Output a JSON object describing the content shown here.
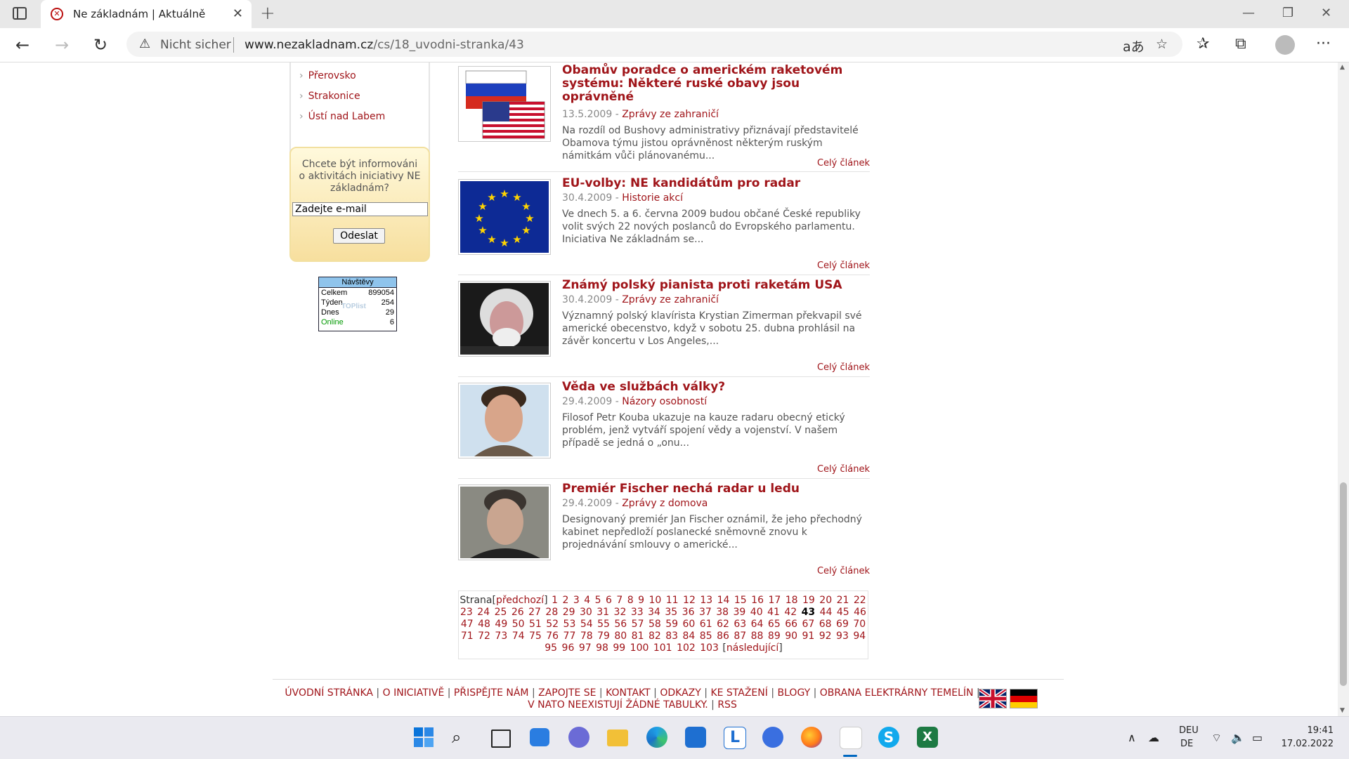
{
  "browser": {
    "tab_title": "Ne základnám | Aktuálně",
    "not_secure": "Nicht sicher",
    "url_domain": "www.nezakladnam.cz",
    "url_path": "/cs/18_uvodni-stranka/43"
  },
  "sidebar": {
    "regions": [
      "Přerovsko",
      "Strakonice",
      "Ústí nad Labem"
    ],
    "newsletter": {
      "prompt": "Chcete být informováni o aktivitách iniciativy NE základnám?",
      "placeholder": "Zadejte e-mail",
      "button": "Odeslat"
    },
    "counter": {
      "title": "Návštěvy",
      "rows": [
        {
          "label": "Celkem",
          "value": "899054"
        },
        {
          "label": "Týden",
          "value": "254"
        },
        {
          "label": "Dnes",
          "value": "29"
        },
        {
          "label": "Online",
          "value": "6"
        }
      ],
      "watermark": "TOPlist"
    }
  },
  "articles": [
    {
      "title": "Obamův poradce o americkém raketovém systému: Některé ruské obavy jsou oprávněné",
      "date": "13.5.2009",
      "category": "Zprávy ze zahraničí",
      "excerpt": "Na rozdíl od Bushovy administrativy přiznávají představitelé Obamova týmu jistou oprávněnost některým ruským námitkám vůči plánovanému...",
      "more": "Celý článek",
      "thumb": "flags-russia-usa"
    },
    {
      "title": "EU-volby: NE kandidátům pro radar",
      "date": "30.4.2009",
      "category": "Historie akcí",
      "excerpt": "Ve dnech 5. a 6. června 2009 budou občané České republiky volit svých 22 nových poslanců do Evropského parlamentu. Iniciativa Ne základnám se...",
      "more": "Celý článek",
      "thumb": "eu-flag"
    },
    {
      "title": "Známý polský pianista proti raketám USA",
      "date": "30.4.2009",
      "category": "Zprávy ze zahraničí",
      "excerpt": "Významný polský klavírista Krystian Zimerman překvapil své americké obecenstvo, když v sobotu 25. dubna prohlásil na závěr koncertu v Los Angeles,...",
      "more": "Celý článek",
      "thumb": "portrait-pianist"
    },
    {
      "title": "Věda ve službách války?",
      "date": "29.4.2009",
      "category": "Názory osobností",
      "excerpt": "Filosof Petr Kouba ukazuje na kauze radaru obecný etický problém, jenž vytváří spojení vědy a vojenství. V našem případě se jedná o „onu...",
      "more": "Celý článek",
      "thumb": "portrait-philosopher"
    },
    {
      "title": "Premiér Fischer nechá radar u ledu",
      "date": "29.4.2009",
      "category": "Zprávy z domova",
      "excerpt": "Designovaný premiér Jan Fischer oznámil, že jeho přechodný kabinet nepředloží poslanecké sněmovně znovu k projednávání smlouvy o americké...",
      "more": "Celý článek",
      "thumb": "portrait-fischer"
    }
  ],
  "pagination": {
    "label": "Strana",
    "prev": "předchozí",
    "next": "následující",
    "current": 43,
    "total": 103
  },
  "footer": {
    "links": [
      "Úvodní stránka",
      "O iniciativě",
      "Přispějte nám",
      "Zapojte se",
      "Kontakt",
      "Odkazy",
      "Ke stažení",
      "Blogy",
      "Obrana Elektrárny Temelín",
      "V NATO neexistují žádné tabulky.",
      "RSS"
    ]
  },
  "taskbar": {
    "lang1": "DEU",
    "lang2": "DE",
    "time": "19:41",
    "date": "17.02.2022"
  },
  "colors": {
    "link": "#a0151a",
    "accent_blue": "#0067c0"
  }
}
